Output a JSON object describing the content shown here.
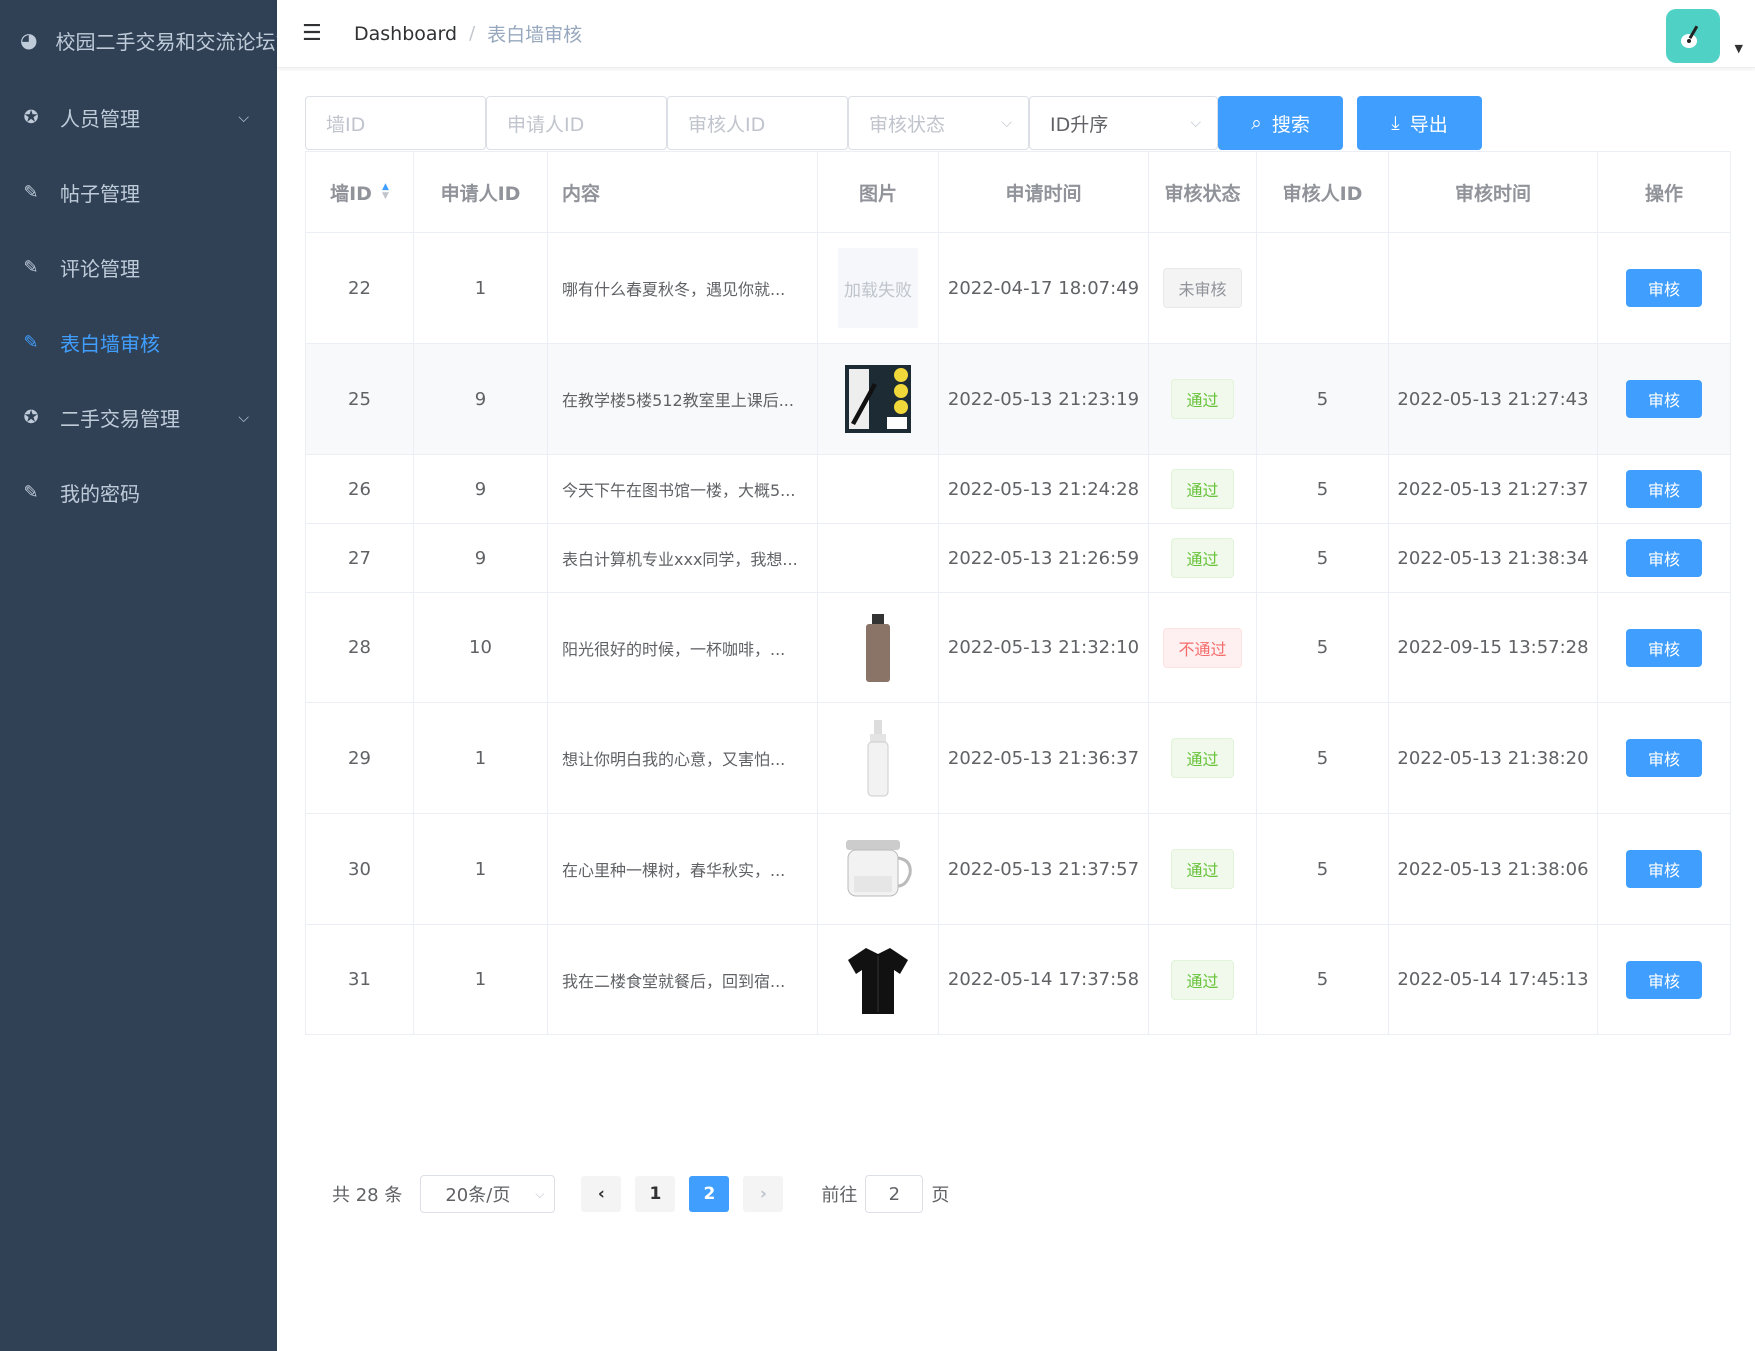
{
  "sidebar": {
    "title": "校园二手交易和交流论坛管",
    "items": [
      {
        "label": "人员管理",
        "icon": "gear-icon",
        "expandable": true
      },
      {
        "label": "帖子管理",
        "icon": "edit-icon",
        "expandable": false
      },
      {
        "label": "评论管理",
        "icon": "edit-icon",
        "expandable": false
      },
      {
        "label": "表白墙审核",
        "icon": "edit-icon",
        "expandable": false,
        "active": true
      },
      {
        "label": "二手交易管理",
        "icon": "gear-icon",
        "expandable": true
      },
      {
        "label": "我的密码",
        "icon": "edit-icon",
        "expandable": false
      }
    ]
  },
  "navbar": {
    "crumb1": "Dashboard",
    "separator": "/",
    "crumb2": "表白墙审核"
  },
  "filters": {
    "wall_id_placeholder": "墙ID",
    "applicant_id_placeholder": "申请人ID",
    "reviewer_id_placeholder": "审核人ID",
    "status_placeholder": "审核状态",
    "sort_value": "ID升序",
    "search_label": "搜索",
    "export_label": "导出"
  },
  "table": {
    "headers": [
      "墙ID",
      "申请人ID",
      "内容",
      "图片",
      "申请时间",
      "审核状态",
      "审核人ID",
      "审核时间",
      "操作"
    ],
    "rows": [
      {
        "id": "22",
        "applicant": "1",
        "content": "哪有什么春夏秋冬，遇见你就...",
        "image": "加载失败",
        "apply_time": "2022-04-17 18:07:49",
        "status": "未审核",
        "status_type": "pending",
        "reviewer": "",
        "review_time": "",
        "action": "审核"
      },
      {
        "id": "25",
        "applicant": "9",
        "content": "在教学楼5楼512教室里上课后...",
        "image": "book-cover",
        "apply_time": "2022-05-13 21:23:19",
        "status": "通过",
        "status_type": "pass",
        "reviewer": "5",
        "review_time": "2022-05-13 21:27:43",
        "action": "审核"
      },
      {
        "id": "26",
        "applicant": "9",
        "content": "今天下午在图书馆一楼，大概5...",
        "image": "",
        "apply_time": "2022-05-13 21:24:28",
        "status": "通过",
        "status_type": "pass",
        "reviewer": "5",
        "review_time": "2022-05-13 21:27:37",
        "action": "审核"
      },
      {
        "id": "27",
        "applicant": "9",
        "content": "表白计算机专业xxx同学，我想...",
        "image": "",
        "apply_time": "2022-05-13 21:26:59",
        "status": "通过",
        "status_type": "pass",
        "reviewer": "5",
        "review_time": "2022-05-13 21:38:34",
        "action": "审核"
      },
      {
        "id": "28",
        "applicant": "10",
        "content": "阳光很好的时候，一杯咖啡，...",
        "image": "bottle",
        "apply_time": "2022-05-13 21:32:10",
        "status": "不通过",
        "status_type": "fail",
        "reviewer": "5",
        "review_time": "2022-09-15 13:57:28",
        "action": "审核"
      },
      {
        "id": "29",
        "applicant": "1",
        "content": "想让你明白我的心意，又害怕...",
        "image": "spray-bottle",
        "apply_time": "2022-05-13 21:36:37",
        "status": "通过",
        "status_type": "pass",
        "reviewer": "5",
        "review_time": "2022-05-13 21:38:20",
        "action": "审核"
      },
      {
        "id": "30",
        "applicant": "1",
        "content": "在心里种一棵树，春华秋实，...",
        "image": "teapot",
        "apply_time": "2022-05-13 21:37:57",
        "status": "通过",
        "status_type": "pass",
        "reviewer": "5",
        "review_time": "2022-05-13 21:38:06",
        "action": "审核"
      },
      {
        "id": "31",
        "applicant": "1",
        "content": "我在二楼食堂就餐后，回到宿...",
        "image": "black-shirt",
        "apply_time": "2022-05-14 17:37:58",
        "status": "通过",
        "status_type": "pass",
        "reviewer": "5",
        "review_time": "2022-05-14 17:45:13",
        "action": "审核"
      }
    ]
  },
  "pagination": {
    "total": "共 28 条",
    "page_size": "20条/页",
    "pages": [
      "1",
      "2"
    ],
    "current": "2",
    "goto_label": "前往",
    "goto_value": "2",
    "page_suffix": "页"
  },
  "colors": {
    "sidebar_bg": "#304156",
    "primary": "#409eff",
    "pass": "#67c23a",
    "fail": "#f56c6c"
  }
}
